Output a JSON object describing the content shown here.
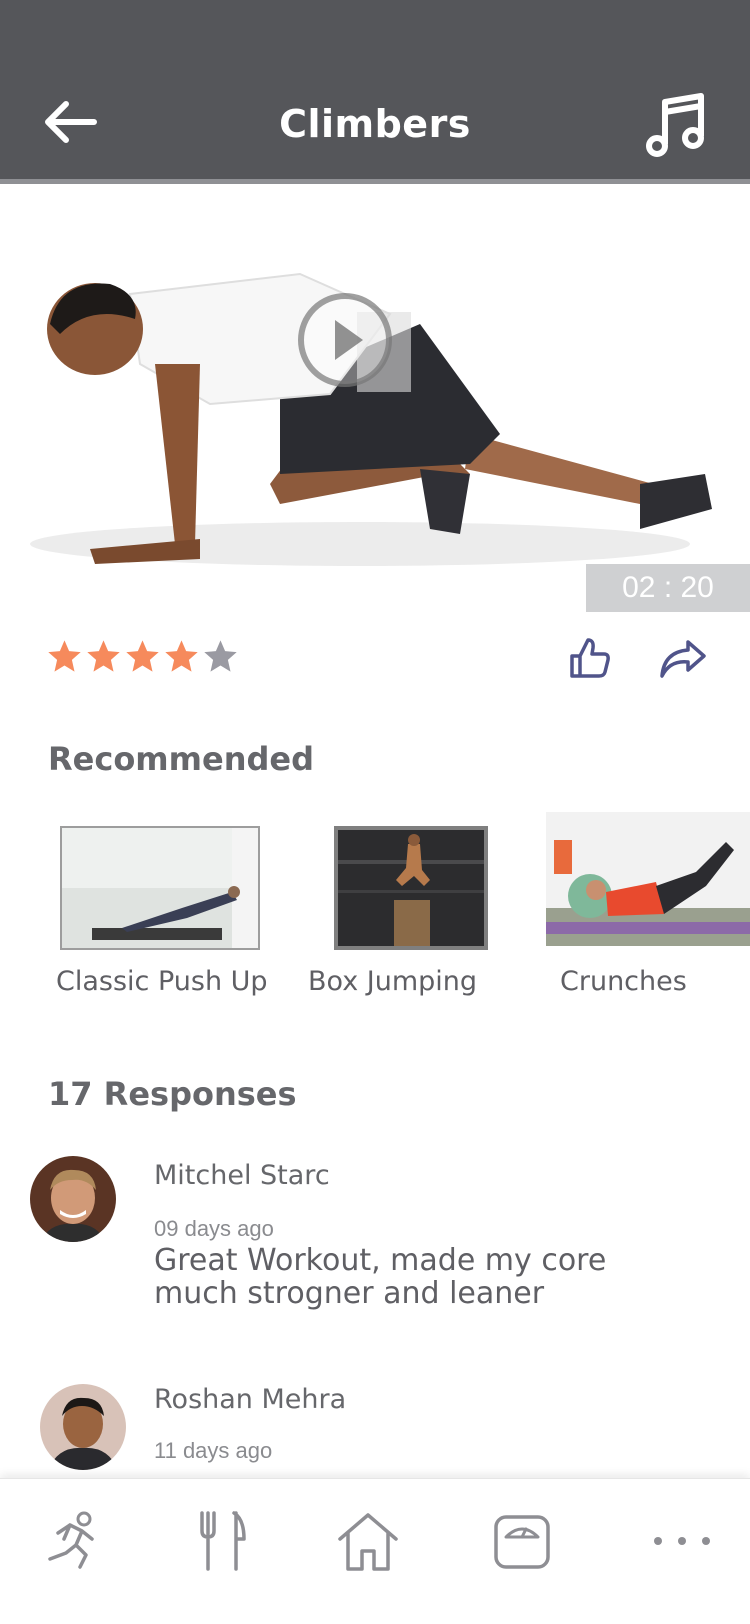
{
  "header": {
    "title": "Climbers",
    "back_icon": "arrow-left-icon",
    "music_icon": "music-note-icon"
  },
  "video": {
    "duration": "02 : 20",
    "play_icon": "play-icon"
  },
  "rating": {
    "value": 4,
    "max": 5,
    "filled_color": "#f68a5c",
    "empty_color": "#9a9aa2"
  },
  "actions": {
    "like_icon": "thumbs-up-icon",
    "share_icon": "share-icon",
    "icon_color": "#50548a"
  },
  "recommended": {
    "title": "Recommended",
    "items": [
      {
        "label": "Classic Push Up"
      },
      {
        "label": "Box Jumping"
      },
      {
        "label": "Crunches"
      }
    ]
  },
  "responses": {
    "title": "17 Responses",
    "items": [
      {
        "name": "Mitchel Starc",
        "date": "09 days ago",
        "text": "Great Workout, made my core much strogner and leaner"
      },
      {
        "name": "Roshan Mehra",
        "date": "11 days ago"
      }
    ]
  },
  "bottom_nav": {
    "items": [
      {
        "icon": "running-icon"
      },
      {
        "icon": "fork-knife-icon"
      },
      {
        "icon": "home-icon"
      },
      {
        "icon": "scale-icon"
      },
      {
        "icon": "more-icon"
      }
    ]
  },
  "colors": {
    "header_bg": "#55565a",
    "accent": "#f68a5c"
  }
}
